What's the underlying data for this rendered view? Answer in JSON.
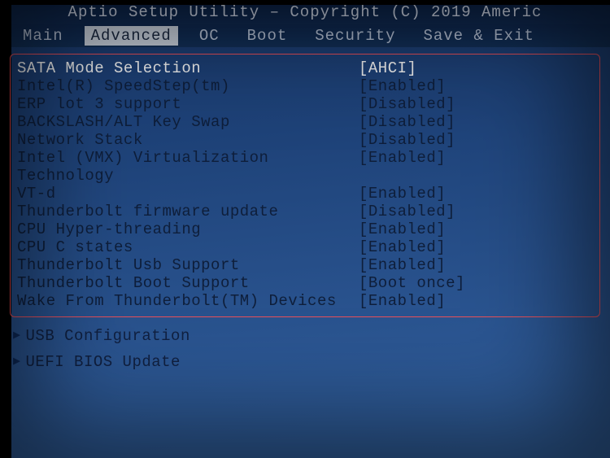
{
  "header": {
    "title": "Aptio Setup Utility – Copyright (C) 2019 Americ"
  },
  "tabs": [
    {
      "label": "Main",
      "active": false
    },
    {
      "label": "Advanced",
      "active": true
    },
    {
      "label": "OC",
      "active": false
    },
    {
      "label": "Boot",
      "active": false
    },
    {
      "label": "Security",
      "active": false
    },
    {
      "label": "Save & Exit",
      "active": false
    }
  ],
  "settings": [
    {
      "label": "SATA Mode Selection",
      "value": "[AHCI]",
      "selected": true
    },
    {
      "label": "Intel(R) SpeedStep(tm)",
      "value": "[Enabled]",
      "selected": false
    },
    {
      "label": "ERP lot 3 support",
      "value": "[Disabled]",
      "selected": false
    },
    {
      "label": "BACKSLASH/ALT Key Swap",
      "value": "[Disabled]",
      "selected": false
    },
    {
      "label": "Network Stack",
      "value": "[Disabled]",
      "selected": false
    },
    {
      "label": "Intel (VMX) Virtualization",
      "value": "[Enabled]",
      "selected": false
    },
    {
      "label": "Technology",
      "value": "",
      "selected": false
    },
    {
      "label": "VT-d",
      "value": "[Enabled]",
      "selected": false
    },
    {
      "label": "Thunderbolt firmware update",
      "value": "[Disabled]",
      "selected": false
    },
    {
      "label": "CPU Hyper-threading",
      "value": "[Enabled]",
      "selected": false
    },
    {
      "label": "CPU C states",
      "value": "[Enabled]",
      "selected": false
    },
    {
      "label": "Thunderbolt Usb Support",
      "value": "[Enabled]",
      "selected": false
    },
    {
      "label": "Thunderbolt Boot Support",
      "value": "[Boot once]",
      "selected": false
    },
    {
      "label": "Wake From Thunderbolt(TM) Devices",
      "value": "[Enabled]",
      "selected": false
    }
  ],
  "submenus": [
    {
      "label": "USB Configuration"
    },
    {
      "label": "UEFI BIOS Update"
    }
  ]
}
